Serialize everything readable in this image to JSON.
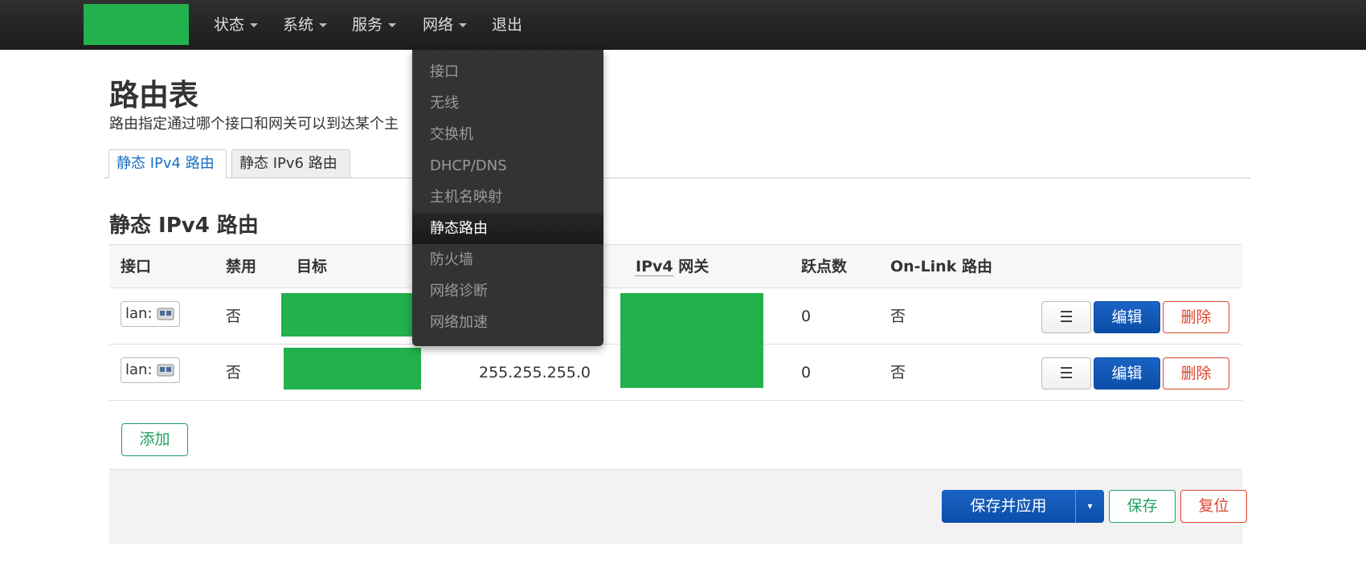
{
  "nav": {
    "items": [
      {
        "label": "状态"
      },
      {
        "label": "系统"
      },
      {
        "label": "服务"
      },
      {
        "label": "网络"
      },
      {
        "label": "退出"
      }
    ]
  },
  "network_menu": {
    "items": [
      {
        "label": "接口"
      },
      {
        "label": "无线"
      },
      {
        "label": "交换机"
      },
      {
        "label": "DHCP/DNS"
      },
      {
        "label": "主机名映射"
      },
      {
        "label": "静态路由"
      },
      {
        "label": "防火墙"
      },
      {
        "label": "网络诊断"
      },
      {
        "label": "网络加速"
      }
    ],
    "active": "静态路由"
  },
  "page": {
    "title": "路由表",
    "description": "路由指定通过哪个接口和网关可以到达某个主"
  },
  "tabs": [
    {
      "label": "静态 IPv4 路由"
    },
    {
      "label": "静态 IPv6 路由"
    }
  ],
  "section": {
    "title": "静态 IPv4 路由"
  },
  "table": {
    "headers": {
      "interface": "接口",
      "disabled": "禁用",
      "target": "目标",
      "gateway_prefix": "IPv4",
      "gateway_suffix": " 网关",
      "metric": "跃点数",
      "onlink": "On-Link 路由"
    },
    "rows": [
      {
        "interface": "lan:",
        "disabled": "否",
        "netmask": "",
        "metric": "0",
        "onlink": "否"
      },
      {
        "interface": "lan:",
        "disabled": "否",
        "netmask": "255.255.255.0",
        "metric": "0",
        "onlink": "否"
      }
    ],
    "row_actions": {
      "more": "☰",
      "edit": "编辑",
      "delete": "删除"
    }
  },
  "add_button": "添加",
  "footer": {
    "apply": "保存并应用",
    "apply_caret": "▾",
    "save": "保存",
    "reset": "复位"
  },
  "colors": {
    "navbar": "#222222",
    "primary": "#0b4ea8",
    "success": "#20a060",
    "danger": "#e0442f",
    "redaction": "#22b14c"
  }
}
